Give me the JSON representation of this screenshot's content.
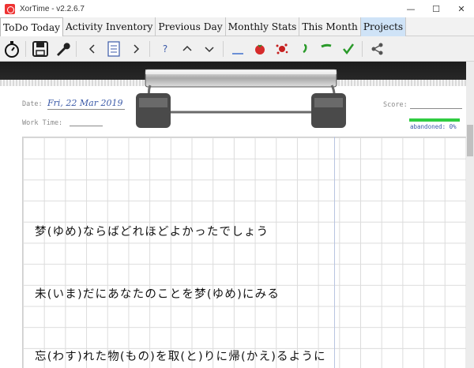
{
  "window": {
    "title": "XorTime - v2.2.6.7",
    "controls": [
      "—",
      "☐",
      "✕"
    ]
  },
  "tabs": [
    {
      "label": "ToDo Today",
      "active": true
    },
    {
      "label": "Activity Inventory"
    },
    {
      "label": "Previous Day"
    },
    {
      "label": "Monthly Stats"
    },
    {
      "label": "This Month"
    },
    {
      "label": "Projects",
      "highlighted": true
    }
  ],
  "toolbar": {
    "buttons": [
      "stopwatch-icon",
      "save-icon",
      "wrench-icon",
      "prev-icon",
      "list-icon",
      "next-icon",
      "help-icon",
      "up-icon",
      "down-icon",
      "underline-icon",
      "tomato-icon",
      "splat-icon",
      "comma-icon",
      "dash-icon",
      "checkmark-icon",
      "share-icon"
    ]
  },
  "sheet": {
    "date_label": "Date:",
    "date_value": "Fri, 22 Mar 2019",
    "work_time_label": "Work Time:",
    "score_label": "Score:",
    "abandoned_text": "abandoned: 0%",
    "progress_fraction": 1.0
  },
  "todos": [
    "梦(ゆめ)ならばどれほどよかったでしょう",
    "未(いま)だにあなたのことを梦(ゆめ)にみる",
    "忘(わす)れた物(もの)を取(と)りに帰(かえ)るように"
  ],
  "colors": {
    "accent": "#3b5aa8",
    "progress": "#2ecc40",
    "projects_tab": "#cfe3f7"
  }
}
